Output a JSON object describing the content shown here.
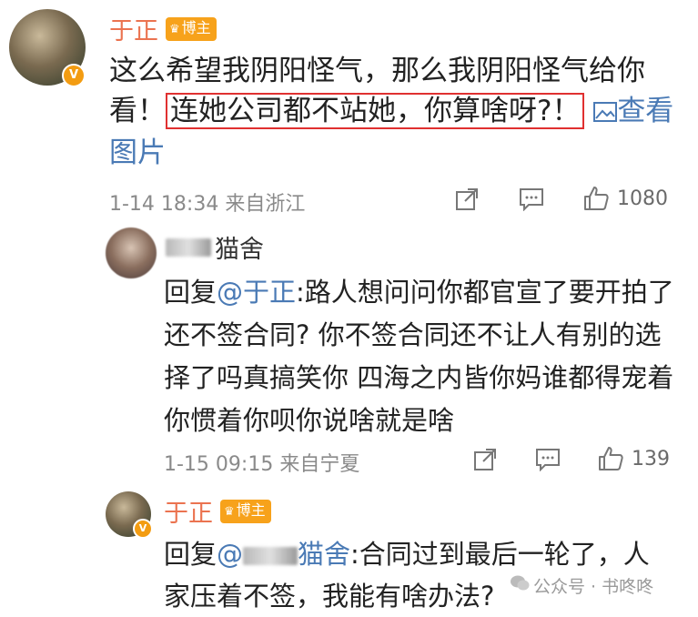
{
  "comment1": {
    "author": "于正",
    "badge": "博主",
    "text_before": "这么希望我阴阳怪气，那么我阴阳怪气给你看！",
    "highlighted": "连她公司都不站她，你算啥呀?！",
    "view_image": "查看图片",
    "timestamp": "1-14 18:34",
    "location": "来自浙江",
    "like_count": "1080"
  },
  "reply1": {
    "author_suffix": "猫舍",
    "reply_prefix": "回复",
    "mention": "@于正",
    "text": ":路人想问问你都官宣了要开拍了还不签合同? 你不签合同还不让人有别的选择了吗真搞笑你 四海之内皆你妈谁都得宠着你惯着你呗你说啥就是啥",
    "timestamp": "1-15 09:15",
    "location": "来自宁夏",
    "like_count": "139"
  },
  "reply2": {
    "author": "于正",
    "badge": "博主",
    "reply_prefix": "回复",
    "mention_prefix": "@",
    "mention_suffix": "猫舍",
    "text": ":合同过到最后一轮了，人家压着不签，我能有啥办法?"
  },
  "watermark": {
    "text": "公众号 · 书咚咚"
  },
  "icons": [
    "share-icon",
    "comment-icon",
    "like-icon",
    "picture-icon",
    "verified-v-icon",
    "crown-icon"
  ],
  "colors": {
    "name": "#eb7350",
    "link": "#4a7ab5",
    "highlight_border": "#e03030",
    "badge": "#f7a21b"
  }
}
